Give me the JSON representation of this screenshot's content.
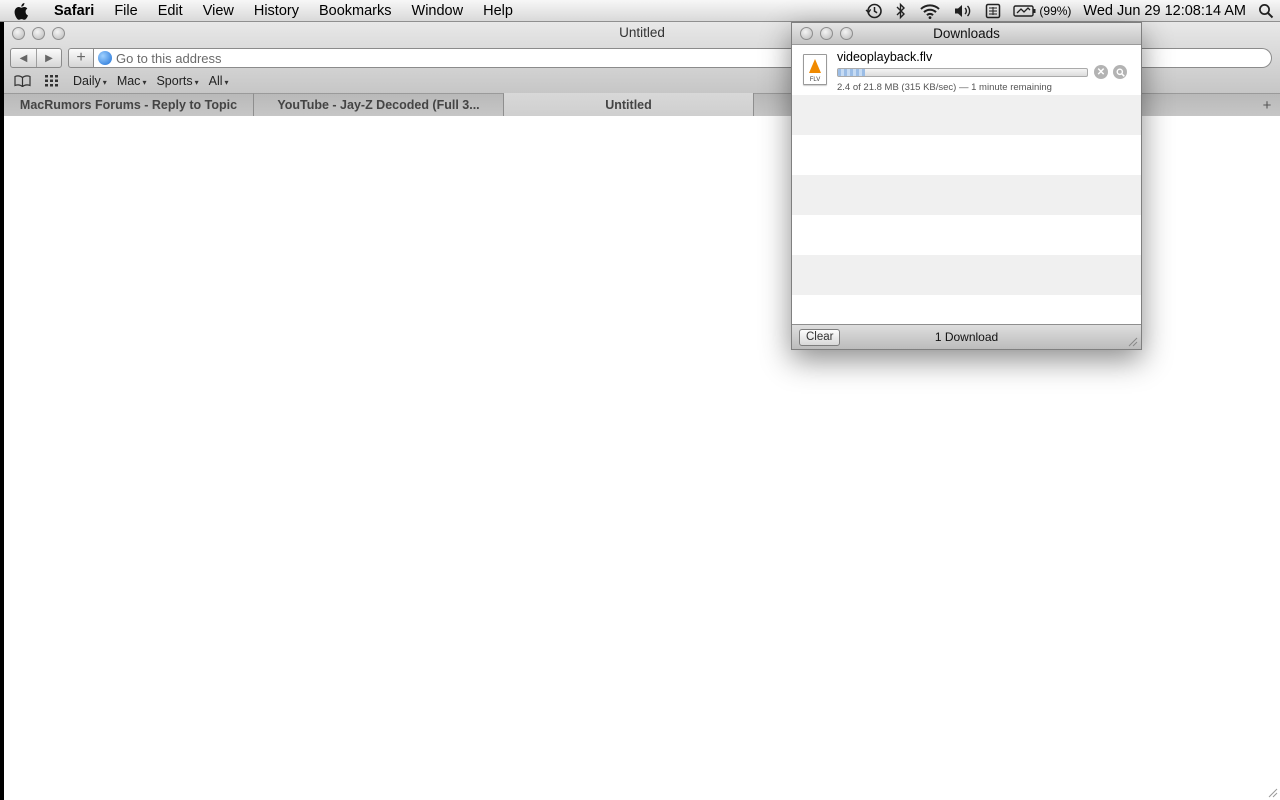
{
  "menubar": {
    "apple_icon": "apple-logo",
    "app_name": "Safari",
    "items": [
      "File",
      "Edit",
      "View",
      "History",
      "Bookmarks",
      "Window",
      "Help"
    ],
    "battery_pct": "(99%)",
    "clock": "Wed Jun 29  12:08:14 AM"
  },
  "safari": {
    "title": "Untitled",
    "address_placeholder": "Go to this address",
    "bookmarks": [
      {
        "label": "Daily",
        "caret": "▾"
      },
      {
        "label": "Mac",
        "caret": "▾"
      },
      {
        "label": "Sports",
        "caret": "▾"
      },
      {
        "label": "All",
        "caret": "▾"
      }
    ],
    "tabs": [
      {
        "label": "MacRumors Forums - Reply to Topic"
      },
      {
        "label": "YouTube - Jay-Z Decoded (Full 3..."
      },
      {
        "label": "Untitled"
      }
    ],
    "new_tab_glyph": "+"
  },
  "downloads": {
    "title": "Downloads",
    "item": {
      "filename": "videoplayback.flv",
      "file_ext": "FLV",
      "progress_fraction": 0.11,
      "status": "2.4 of 21.8 MB (315 KB/sec) — 1 minute remaining"
    },
    "clear_label": "Clear",
    "count_label": "1 Download"
  }
}
